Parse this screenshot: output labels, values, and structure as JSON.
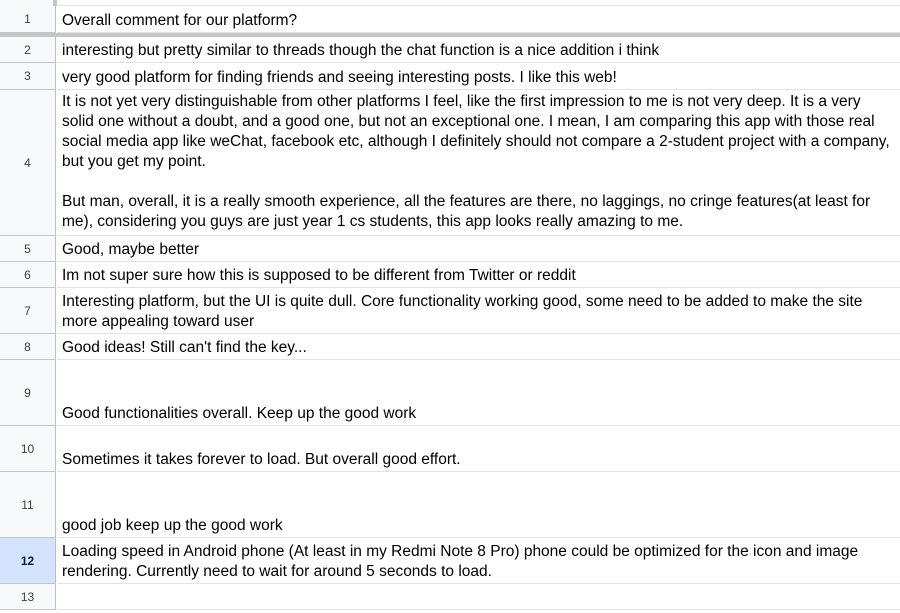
{
  "sheet": {
    "rows": [
      {
        "num": "1",
        "text": "Overall comment for our platform?"
      },
      {
        "num": "2",
        "text": "interesting but pretty similar to threads though the chat function is a nice addition i think"
      },
      {
        "num": "3",
        "text": "very good platform for finding friends and seeing interesting posts. I like this web!"
      },
      {
        "num": "4",
        "text": "It is not yet very distinguishable from other platforms I feel, like the first impression to me is not very deep. It is a very solid one without a doubt, and a good one, but not an exceptional one. I mean, I am comparing this app with those real social media app like weChat, facebook etc, although I definitely should not compare a 2-student project with a company, but you get my point.\n\nBut man, overall, it is a really smooth experience, all the features are there, no laggings, no cringe features(at least for me), considering you guys are just year 1 cs students, this app looks really amazing to me."
      },
      {
        "num": "5",
        "text": "Good, maybe better"
      },
      {
        "num": "6",
        "text": "Im not super sure how this is supposed to be different from Twitter or reddit"
      },
      {
        "num": "7",
        "text": "Interesting platform, but the UI is quite dull. Core functionality working good, some need to be added to make the site more appealing toward user"
      },
      {
        "num": "8",
        "text": "Good ideas! Still can't find the key..."
      },
      {
        "num": "9",
        "text": "Good functionalities overall. Keep up the good work"
      },
      {
        "num": "10",
        "text": "Sometimes it takes forever to load. But overall good effort."
      },
      {
        "num": "11",
        "text": "good job keep up the good work"
      },
      {
        "num": "12",
        "text": "Loading speed in Android phone (At least in my Redmi Note 8 Pro) phone could be optimized for the icon and image rendering. Currently need to wait for around 5 seconds to load."
      },
      {
        "num": "13",
        "text": ""
      }
    ],
    "selected_row": "12"
  }
}
